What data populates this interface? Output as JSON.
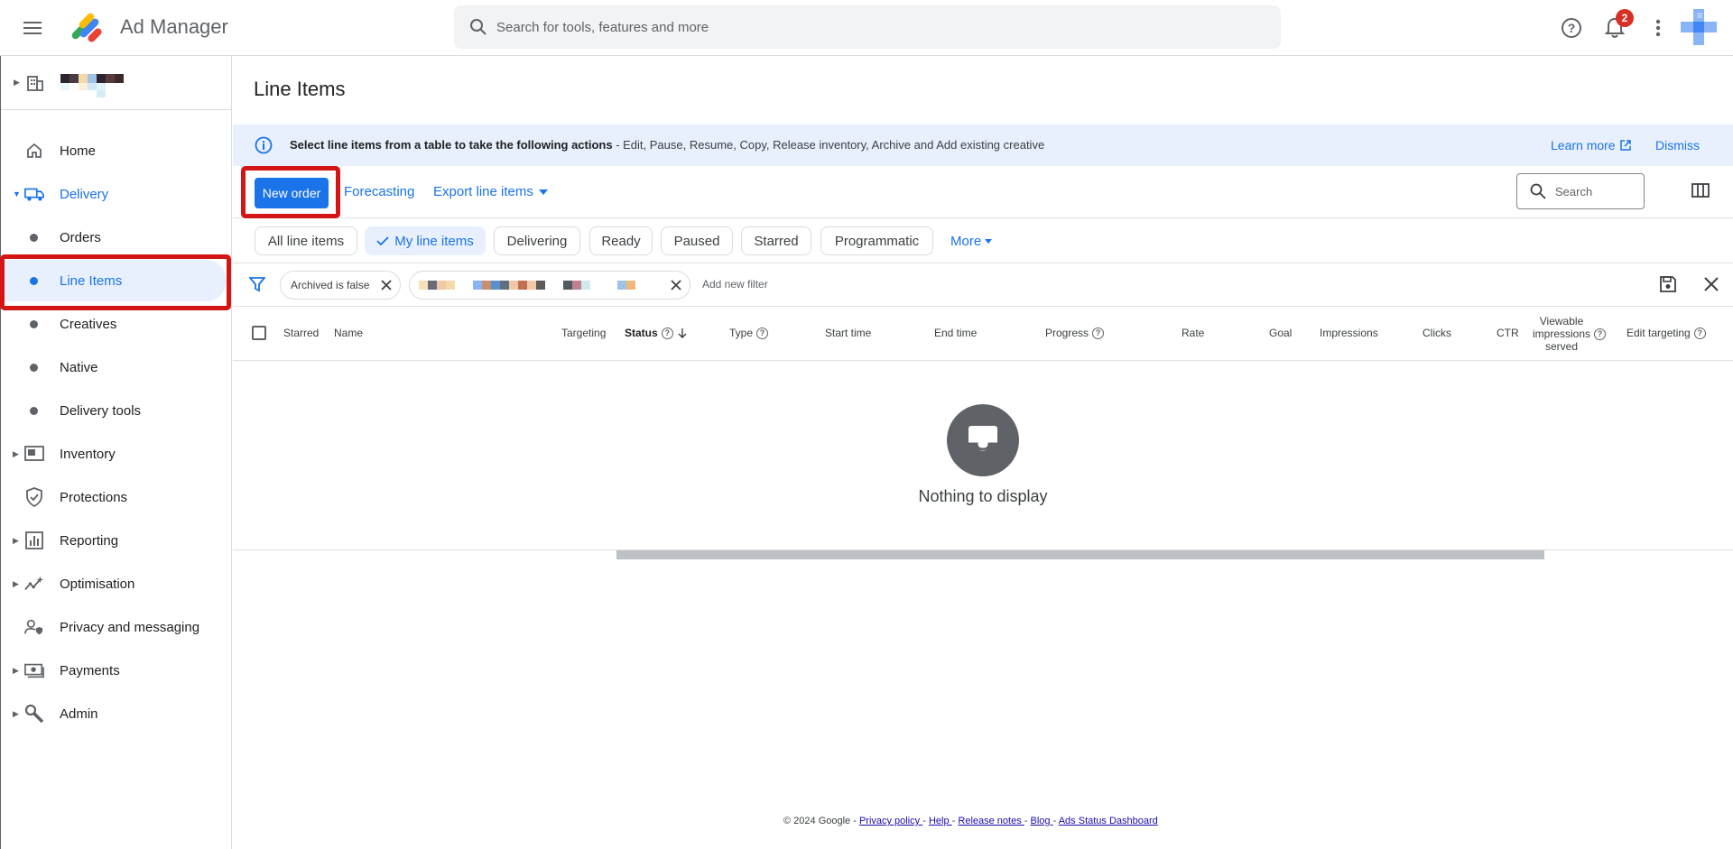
{
  "header": {
    "app_title": "Ad Manager",
    "search_placeholder": "Search for tools, features and more",
    "notification_count": "2"
  },
  "sidebar": {
    "items": [
      {
        "label": "Home",
        "icon": "home-icon"
      },
      {
        "label": "Delivery",
        "icon": "truck-icon"
      },
      {
        "label": "Orders"
      },
      {
        "label": "Line Items"
      },
      {
        "label": "Creatives"
      },
      {
        "label": "Native"
      },
      {
        "label": "Delivery tools"
      },
      {
        "label": "Inventory",
        "icon": "inventory-icon"
      },
      {
        "label": "Protections",
        "icon": "shield-icon"
      },
      {
        "label": "Reporting",
        "icon": "reporting-icon"
      },
      {
        "label": "Optimisation",
        "icon": "optimisation-icon"
      },
      {
        "label": "Privacy and messaging",
        "icon": "privacy-icon"
      },
      {
        "label": "Payments",
        "icon": "payments-icon"
      },
      {
        "label": "Admin",
        "icon": "wrench-icon"
      }
    ]
  },
  "main": {
    "title": "Line Items",
    "banner": {
      "bold": "Select line items from a table to take the following actions",
      "rest": " - Edit, Pause, Resume, Copy, Release inventory, Archive and Add existing creative",
      "learn_more": "Learn more",
      "dismiss": "Dismiss"
    },
    "toolbar": {
      "new_order": "New order",
      "forecasting": "Forecasting",
      "export": "Export line items",
      "search_placeholder": "Search"
    },
    "chips": [
      "All line items",
      "My line items",
      "Delivering",
      "Ready",
      "Paused",
      "Starred",
      "Programmatic"
    ],
    "more": "More",
    "filters": {
      "archived": "Archived is false",
      "add_filter": "Add new filter"
    },
    "columns": {
      "starred": "Starred",
      "name": "Name",
      "targeting": "Targeting",
      "status": "Status",
      "type": "Type",
      "start_time": "Start time",
      "end_time": "End time",
      "progress": "Progress",
      "rate": "Rate",
      "goal": "Goal",
      "impressions": "Impressions",
      "clicks": "Clicks",
      "ctr": "CTR",
      "viewable_1": "Viewable",
      "viewable_2": "impressions",
      "viewable_3": "served",
      "edit_targeting": "Edit targeting"
    },
    "empty_text": "Nothing to display"
  },
  "footer": {
    "copyright": "© 2024 Google - ",
    "privacy": "Privacy policy ",
    "help": "Help ",
    "release": "Release notes ",
    "blog": "Blog ",
    "status": "Ads Status Dashboard",
    "sep": "- "
  },
  "colors": {
    "accent": "#1a73e8",
    "highlight": "#d31515",
    "banner_bg": "#e8f0fe"
  }
}
